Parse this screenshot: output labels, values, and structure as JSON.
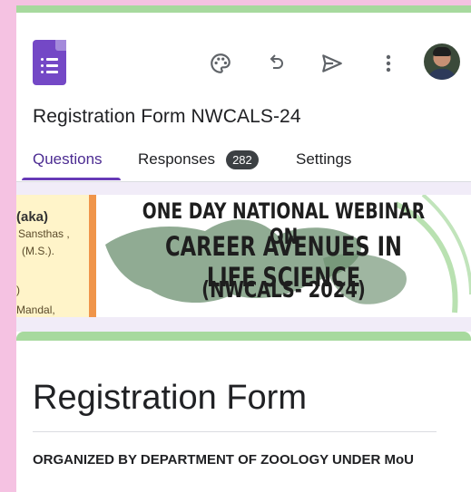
{
  "toolbar": {
    "icons": [
      "palette-icon",
      "undo-icon",
      "send-icon",
      "more-vert-icon"
    ]
  },
  "form": {
    "title": "Registration Form NWCALS-24"
  },
  "tabs": [
    {
      "label": "Questions",
      "active": true
    },
    {
      "label": "Responses",
      "badge": "282"
    },
    {
      "label": "Settings"
    }
  ],
  "banner": {
    "left_name": "(aka)",
    "left_line1": "Sansthas ,",
    "left_line2": "(M.S.).",
    "left_line3": ")",
    "left_line4": "Mandal,",
    "line1": "ONE DAY NATIONAL WEBINAR ON",
    "line2": "CAREER AVENUES IN LIFE SCIENCE",
    "line3": "(NWCALS- 2024)"
  },
  "header_card": {
    "title": "Registration Form",
    "description": "ORGANIZED BY DEPARTMENT OF ZOOLOGY UNDER MoU"
  },
  "colors": {
    "accent": "#673ab7",
    "theme_green": "#a7d99e",
    "page_pink": "#f5c2e2"
  }
}
